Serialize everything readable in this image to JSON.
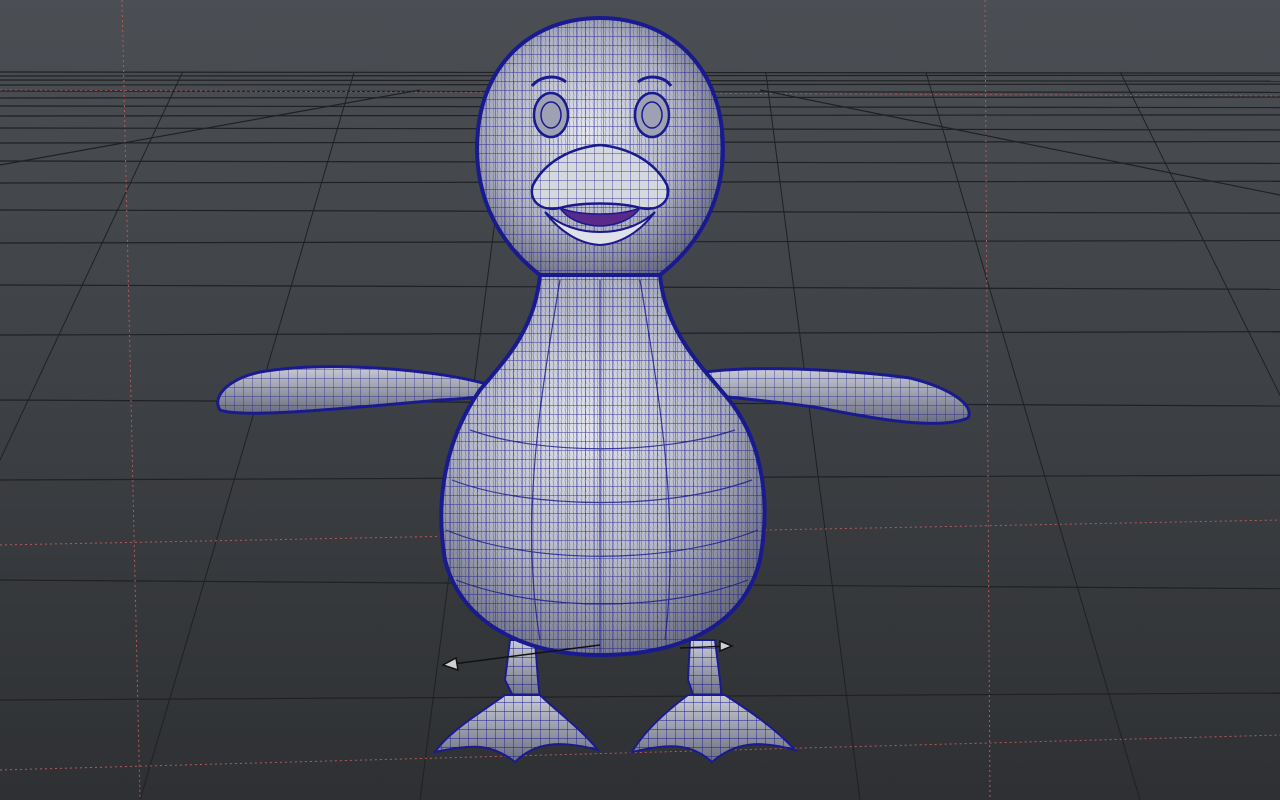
{
  "viewport": {
    "panel": "perspective-viewport",
    "display_mode": "wireframe-on-shaded",
    "selected_object": "duck-character-mesh",
    "colors": {
      "background_top": "#4a4e53",
      "background_bottom": "#2f3134",
      "grid_line": "#1f2123",
      "grid_axis": "#b35a5a",
      "mesh_shade_light": "#d9dbe2",
      "mesh_shade_dark": "#6d7080",
      "wireframe": "#1a1a8f",
      "mouth_interior": "#5a2a8a",
      "manipulator": "#111111"
    }
  }
}
